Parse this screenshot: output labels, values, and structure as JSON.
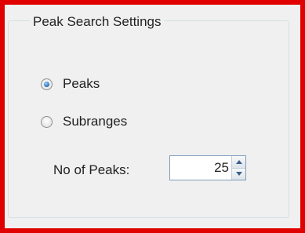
{
  "group": {
    "title": "Peak Search Settings"
  },
  "options": [
    {
      "label": "Peaks",
      "selected": true
    },
    {
      "label": "Subranges",
      "selected": false
    }
  ],
  "num_peaks": {
    "label": "No of Peaks:",
    "value": "25"
  },
  "colors": {
    "highlight_border": "#e00000",
    "panel_bg": "#f0f0f0",
    "radio_accent": "#2f78c4"
  },
  "icons": {
    "spin_up": "spin-up-arrow-icon",
    "spin_down": "spin-down-arrow-icon"
  }
}
